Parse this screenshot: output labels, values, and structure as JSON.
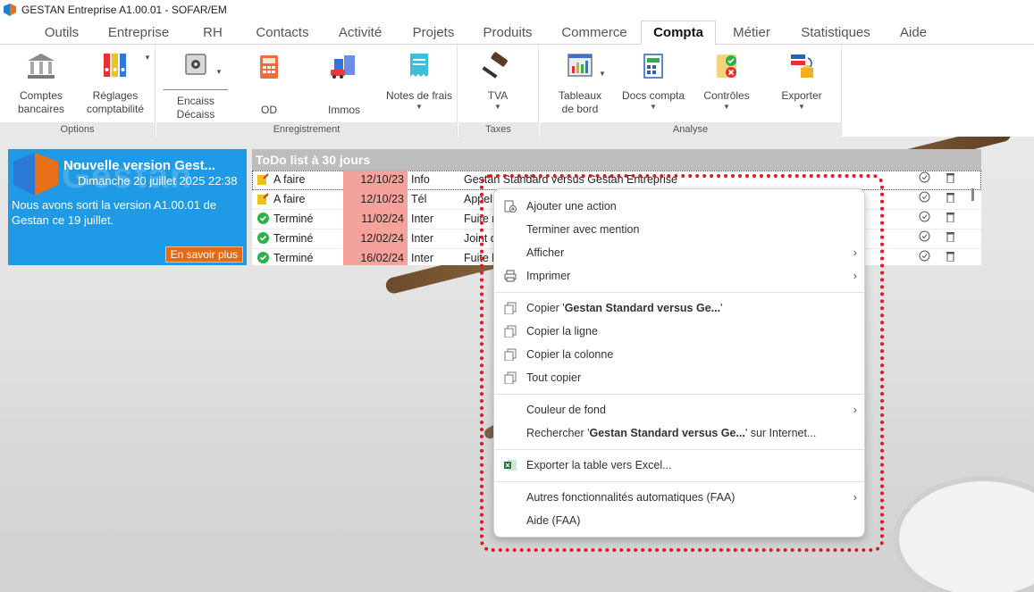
{
  "window": {
    "title": "GESTAN Entreprise A1.00.01 - SOFAR/EM"
  },
  "tabs": [
    {
      "label": "Outils"
    },
    {
      "label": "Entreprise"
    },
    {
      "label": "RH"
    },
    {
      "label": "Contacts"
    },
    {
      "label": "Activité"
    },
    {
      "label": "Projets"
    },
    {
      "label": "Produits"
    },
    {
      "label": "Commerce"
    },
    {
      "label": "Compta",
      "active": true
    },
    {
      "label": "Métier"
    },
    {
      "label": "Statistiques"
    },
    {
      "label": "Aide"
    }
  ],
  "ribbon": {
    "groups": {
      "options": "Options",
      "enregistrement": "Enregistrement",
      "taxes": "Taxes",
      "analyse": "Analyse"
    },
    "buttons": {
      "comptes_bancaires_l1": "Comptes",
      "comptes_bancaires_l2": "bancaires",
      "reglages_l1": "Réglages",
      "reglages_l2": "comptabilité",
      "encaiss_l1": "Encaiss",
      "encaiss_l2": "Décaiss",
      "od": "OD",
      "immos": "Immos",
      "notes_frais": "Notes de frais",
      "tva": "TVA",
      "tableaux_l1": "Tableaux",
      "tableaux_l2": "de bord",
      "docs_compta": "Docs compta",
      "controles": "Contrôles",
      "exporter": "Exporter"
    }
  },
  "news": {
    "title": "Nouvelle version Gest...",
    "date": "Dimanche 20 juillet 2025 22:38",
    "watermark": "Gestan",
    "body": "Nous avons sorti la version A1.00.01 de Gestan ce 19 juillet.",
    "button": "En savoir plus"
  },
  "todo": {
    "header": "ToDo list à 30 jours",
    "rows": [
      {
        "status": "A faire",
        "date": "12/10/23",
        "type": "Info",
        "subject": "Gestan Standard versus Gestan Entreprise"
      },
      {
        "status": "A faire",
        "date": "12/10/23",
        "type": "Tél",
        "subject": "Appel..."
      },
      {
        "status": "Terminé",
        "date": "11/02/24",
        "type": "Inter",
        "subject": "Fuite r..."
      },
      {
        "status": "Terminé",
        "date": "12/02/24",
        "type": "Inter",
        "subject": "Joint d..."
      },
      {
        "status": "Terminé",
        "date": "16/02/24",
        "type": "Inter",
        "subject": "Fuite b..."
      }
    ]
  },
  "context_menu": {
    "items": {
      "ajouter_action": "Ajouter une action",
      "terminer_mention": "Terminer avec mention",
      "afficher": "Afficher",
      "imprimer": "Imprimer",
      "copier_prefix": "Copier '",
      "copier_value": "Gestan Standard versus Ge...",
      "copier_suffix": "'",
      "copier_ligne": "Copier la ligne",
      "copier_colonne": "Copier la colonne",
      "tout_copier": "Tout copier",
      "couleur_fond": "Couleur de fond",
      "rechercher_prefix": "Rechercher '",
      "rechercher_value": "Gestan Standard versus Ge...",
      "rechercher_suffix": "' sur Internet...",
      "exporter_excel": "Exporter la table vers Excel...",
      "autres_faa": "Autres fonctionnalités automatiques (FAA)",
      "aide_faa": "Aide (FAA)"
    },
    "submenu_arrow": "›"
  },
  "colors": {
    "accent_blue": "#1f9ae6",
    "highlight_red": "#e0191e",
    "overdue_date": "#f6a29c",
    "news_button": "#e56a12"
  }
}
